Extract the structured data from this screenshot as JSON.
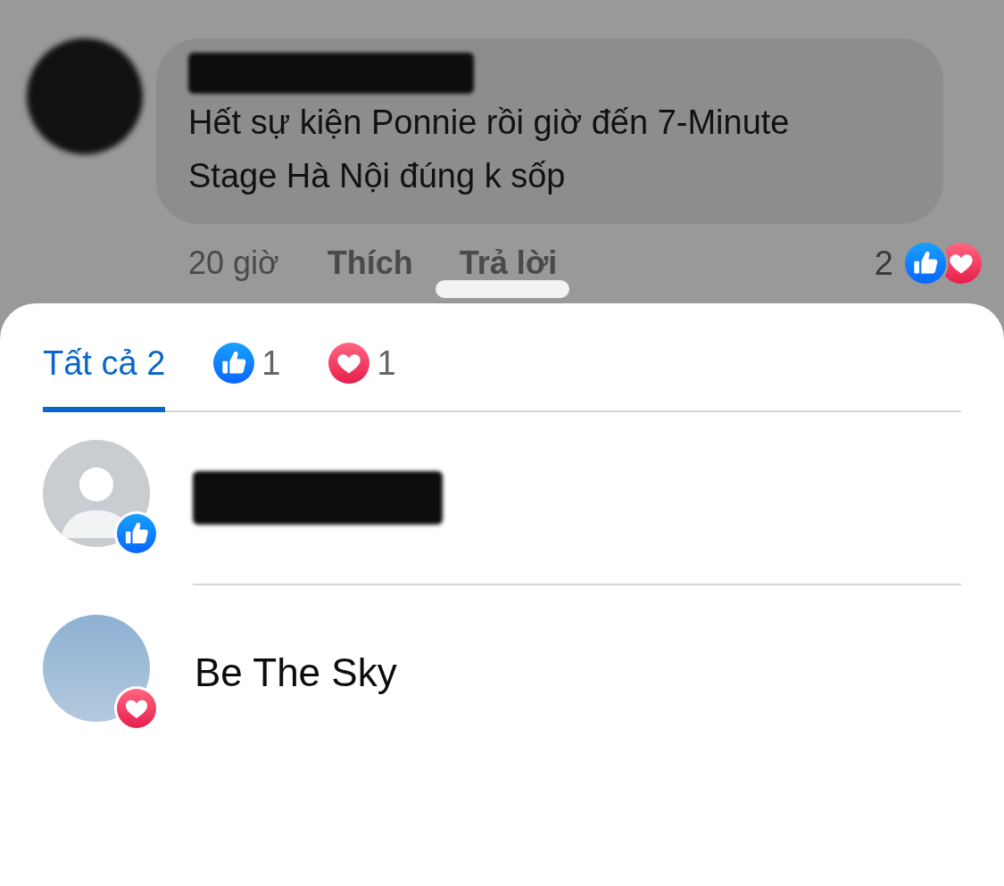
{
  "comment": {
    "author_redacted": true,
    "avatar_redacted": true,
    "text": "Hết sự kiện Ponnie rồi giờ đến 7-Minute Stage Hà Nội đúng k sốp",
    "time": "20 giờ",
    "actions": [
      "Thích",
      "Trả lời"
    ],
    "reaction_count": "2",
    "reactions": [
      {
        "kind": "like"
      },
      {
        "kind": "love"
      }
    ]
  },
  "sheet": {
    "tabs": [
      {
        "kind": "all",
        "label": "Tất cả 2",
        "selected": true
      },
      {
        "kind": "like",
        "label": "1",
        "selected": false
      },
      {
        "kind": "love",
        "label": "1",
        "selected": false
      }
    ],
    "people": [
      {
        "name_redacted": true,
        "avatar": {
          "kind": "default"
        },
        "reaction": {
          "kind": "like"
        }
      },
      {
        "name": "Be The Sky",
        "avatar": {
          "kind": "photo"
        },
        "reaction": {
          "kind": "love"
        }
      }
    ]
  }
}
